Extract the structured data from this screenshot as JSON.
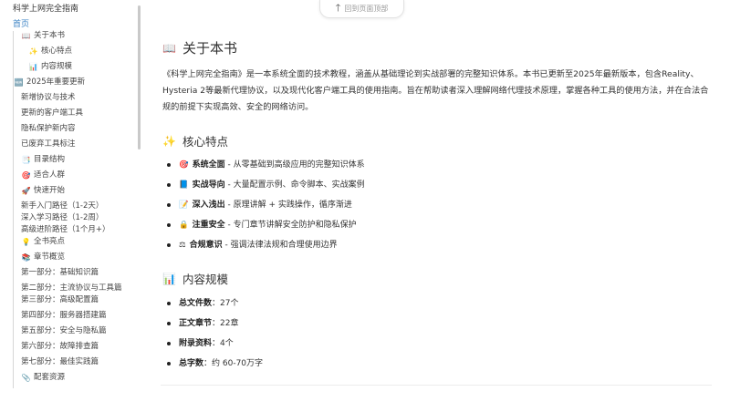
{
  "sidebar": {
    "title": "科学上网完全指南",
    "home": "首页",
    "items": [
      {
        "icon": "📖",
        "label": "关于本书",
        "level": 1
      },
      {
        "icon": "✨",
        "label": "核心特点",
        "level": 2
      },
      {
        "icon": "📊",
        "label": "内容规模",
        "level": 2
      },
      {
        "icon": "🆕",
        "label": "2025年重要更新",
        "level": 0
      },
      {
        "icon": "",
        "label": "新增协议与技术",
        "level": 1
      },
      {
        "icon": "",
        "label": "更新的客户端工具",
        "level": 1
      },
      {
        "icon": "",
        "label": "隐私保护新内容",
        "level": 1
      },
      {
        "icon": "",
        "label": "已废弃工具标注",
        "level": 1
      },
      {
        "icon": "📑",
        "label": "目录结构",
        "level": 1
      },
      {
        "icon": "🎯",
        "label": "适合人群",
        "level": 1
      },
      {
        "icon": "🚀",
        "label": "快速开始",
        "level": 1
      },
      {
        "icon": "",
        "label": "新手入门路径（1-2天）",
        "level": 1
      },
      {
        "icon": "",
        "label": "深入学习路径（1-2周）",
        "level": 1
      },
      {
        "icon": "",
        "label": "高级进阶路径（1个月+）",
        "level": 1
      },
      {
        "icon": "💡",
        "label": "全书亮点",
        "level": 1
      },
      {
        "icon": "📚",
        "label": "章节概览",
        "level": 1
      },
      {
        "icon": "",
        "label": "第一部分：基础知识篇",
        "level": 1
      },
      {
        "icon": "",
        "label": "第二部分：主流协议与工具篇",
        "level": 1
      },
      {
        "icon": "",
        "label": "第三部分：高级配置篇",
        "level": 1
      },
      {
        "icon": "",
        "label": "第四部分：服务器搭建篇",
        "level": 1
      },
      {
        "icon": "",
        "label": "第五部分：安全与隐私篇",
        "level": 1
      },
      {
        "icon": "",
        "label": "第六部分：故障排查篇",
        "level": 1
      },
      {
        "icon": "",
        "label": "第七部分：最佳实践篇",
        "level": 1
      },
      {
        "icon": "📎",
        "label": "配套资源",
        "level": 1
      }
    ]
  },
  "back_to_top": "回到页面顶部",
  "main": {
    "about": {
      "icon": "📖",
      "title": "关于本书",
      "intro": "《科学上网完全指南》是一本系统全面的技术教程，涵盖从基础理论到实战部署的完整知识体系。本书已更新至2025年最新版本，包含Reality、Hysteria 2等最新代理协议，以及现代化客户端工具的使用指南。旨在帮助读者深入理解网络代理技术原理，掌握各种工具的使用方法，并在合法合规的前提下实现高效、安全的网络访问。"
    },
    "features": {
      "icon": "✨",
      "title": "核心特点",
      "items": [
        {
          "icon": "🎯",
          "bold": "系统全面",
          "text": " - 从零基础到高级应用的完整知识体系"
        },
        {
          "icon": "📘",
          "bold": "实战导向",
          "text": " - 大量配置示例、命令脚本、实战案例"
        },
        {
          "icon": "📝",
          "bold": "深入浅出",
          "text": " - 原理讲解 + 实践操作，循序渐进"
        },
        {
          "icon": "🔒",
          "bold": "注重安全",
          "text": " - 专门章节讲解安全防护和隐私保护"
        },
        {
          "icon": "⚖",
          "bold": "合规意识",
          "text": " - 强调法律法规和合理使用边界"
        }
      ]
    },
    "scale": {
      "icon": "📊",
      "title": "内容规模",
      "items": [
        {
          "bold": "总文件数",
          "text": "：27个"
        },
        {
          "bold": "正文章节",
          "text": "：22章"
        },
        {
          "bold": "附录资料",
          "text": "：4个"
        },
        {
          "bold": "总字数",
          "text": "：约 60-70万字"
        }
      ]
    }
  }
}
